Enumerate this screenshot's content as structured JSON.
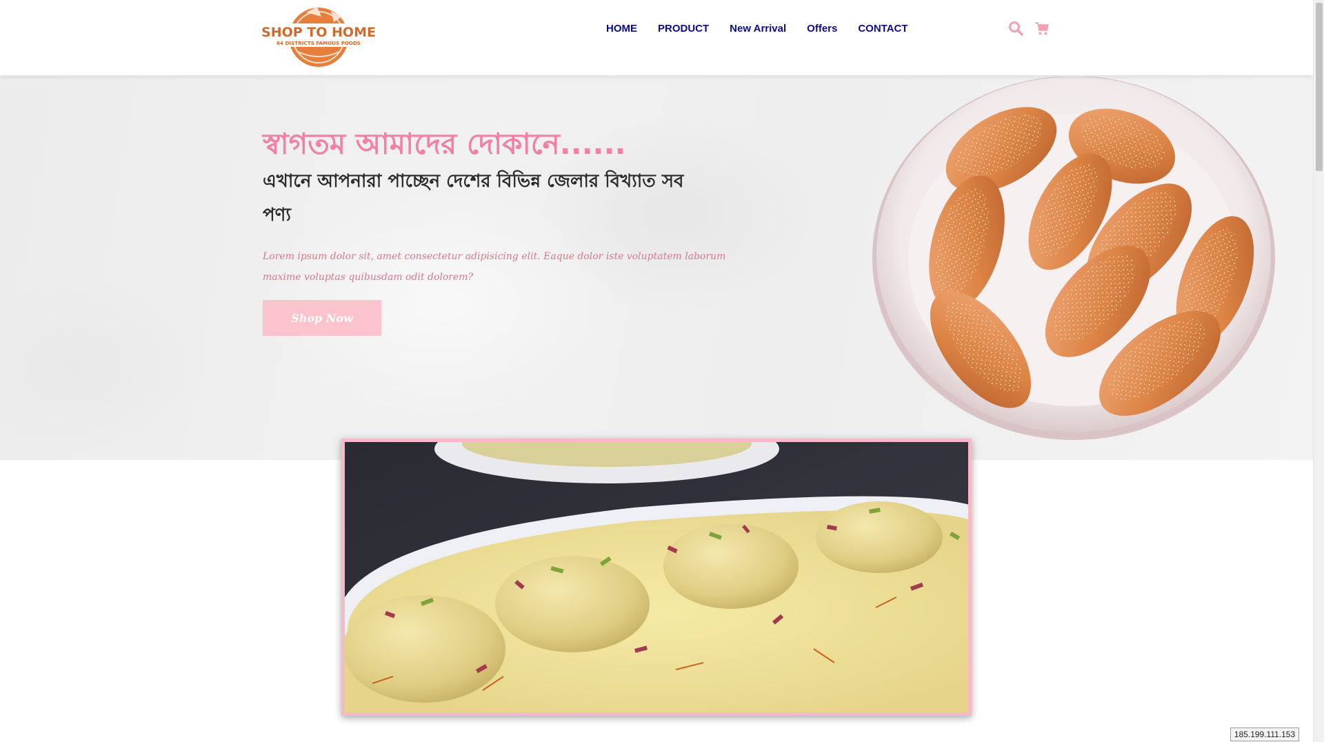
{
  "brand": {
    "name": "SHOP TO HOME",
    "tagline": "64 DISTRICTS FAMOUS FOODS",
    "colors": {
      "primary": "#e67e3c",
      "accent_pink": "#f27fa6",
      "nav_text": "#0b0b8a"
    }
  },
  "nav": {
    "items": [
      {
        "label": "HOME"
      },
      {
        "label": "PRODUCT"
      },
      {
        "label": "New Arrival"
      },
      {
        "label": "Offers"
      },
      {
        "label": "CONTACT"
      }
    ]
  },
  "header_icons": [
    {
      "name": "search-icon",
      "color": "#f2a0b3"
    },
    {
      "name": "cart-icon",
      "color": "#f2a0b3"
    }
  ],
  "hero": {
    "title": "স্বাগতম আমাদের দোকানে......",
    "subtitle": "এখানে আপনারা পাচ্ছেন দেশের বিভিন্ন জেলার বিখ্যাত সব পণ্য",
    "description": "Lorem ipsum dolor sit, amet consectetur adipisicing elit. Eaque dolor iste voluptatem laborum maxime voluptas quibusdam odit dolorem?",
    "button_label": "Shop Now",
    "button_color": "#fac3cd",
    "image": "plate-of-sweets"
  },
  "featured": {
    "image": "rasmalai-dish",
    "frame_color": "#f7b8c8"
  },
  "status": {
    "ip": "185.199.111.153"
  }
}
